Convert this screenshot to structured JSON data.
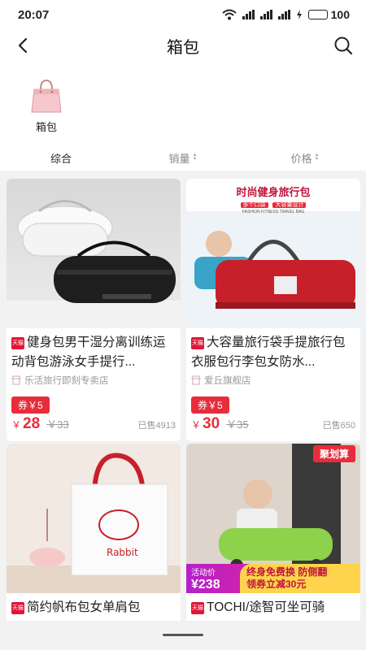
{
  "status": {
    "time": "20:07",
    "battery": "100"
  },
  "nav": {
    "title": "箱包"
  },
  "category": {
    "label": "箱包"
  },
  "sort": {
    "tabs": [
      "综合",
      "销量",
      "价格"
    ]
  },
  "products": [
    {
      "title": "健身包男干湿分离训练运动背包游泳女手提行...",
      "tag": "天猫",
      "shop": "乐活旅行即刻专卖店",
      "coupon": "券￥5",
      "currency": "￥",
      "price": "28",
      "orig_price": "￥33",
      "sold": "已售4913"
    },
    {
      "title": "大容量旅行袋手提旅行包衣服包行李包女防水...",
      "tag": "天猫",
      "shop": "爱丘旗舰店",
      "coupon": "券￥5",
      "currency": "￥",
      "price": "30",
      "orig_price": "￥35",
      "sold": "已售650",
      "banner_title": "时尚健身旅行包",
      "banner_tags": [
        "多个口袋",
        "大容量设计"
      ],
      "banner_sub": "FASHION FITNESS TRAVEL BAG"
    },
    {
      "title": "简约帆布包女单肩包",
      "tag": "天猫",
      "print_text": "Rabbit"
    },
    {
      "title": "TOCHI/途智可坐可骑",
      "tag": "天猫",
      "promo_badge": "聚划算",
      "promo_label": "活动价",
      "promo_price": "¥238",
      "promo_line1": "终身免费换 防侧翻",
      "promo_line2": "领券立减30元"
    }
  ],
  "colors": {
    "accent": "#e82c3c",
    "tmall": "#e31436"
  }
}
